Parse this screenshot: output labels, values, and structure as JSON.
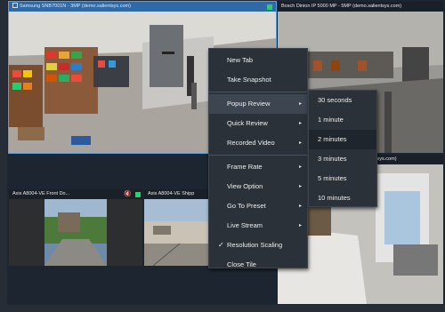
{
  "tiles": [
    {
      "title": "Samsung SNB7001N - 3MP (demo.salientsys.com)"
    },
    {
      "title": "Bosch Dinion IP 5000 MP - 5MP (demo.salientsys.com)"
    },
    {
      "title": "Axis A8004-VE Front Do..."
    },
    {
      "title": "Axis A8004-VE Shipp"
    },
    {
      "title_fragment": "tsys.com)"
    }
  ],
  "context_menu": {
    "items": [
      {
        "label": "New Tab"
      },
      {
        "label": "Take Snapshot"
      },
      {
        "label": "Popup Review",
        "submenu": true,
        "highlighted": true
      },
      {
        "label": "Quick Review",
        "submenu": true
      },
      {
        "label": "Recorded Video",
        "submenu": true
      },
      {
        "label": "Frame Rate",
        "submenu": true
      },
      {
        "label": "View Option",
        "submenu": true
      },
      {
        "label": "Go To Preset",
        "submenu": true
      },
      {
        "label": "Live Stream",
        "submenu": true
      },
      {
        "label": "Resolution Scaling",
        "checked": true,
        "check_glyph": "✓"
      },
      {
        "label": "Close Tile"
      }
    ],
    "arrow_glyph": "▸"
  },
  "popup_review_submenu": {
    "items": [
      {
        "label": "30 seconds"
      },
      {
        "label": "1 minute"
      },
      {
        "label": "2 minutes",
        "highlighted": true
      },
      {
        "label": "3 minutes"
      },
      {
        "label": "5 minutes"
      },
      {
        "label": "10 minutes"
      }
    ]
  },
  "icons": {
    "mute": "🔇"
  },
  "colors": {
    "selected_titlebar": "#2f6aa6",
    "recording_indicator": "#2ecc71",
    "menu_bg": "#2b3138"
  }
}
